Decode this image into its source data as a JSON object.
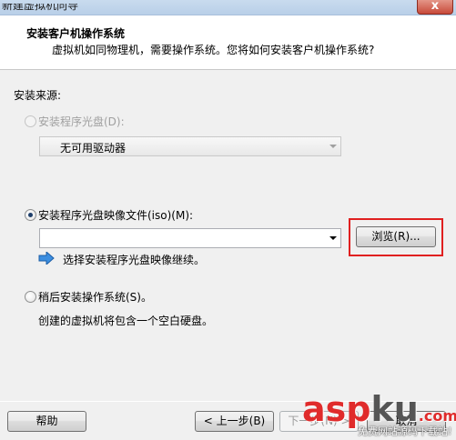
{
  "window": {
    "title": "新建虚拟机向导",
    "close_glyph": "x"
  },
  "header": {
    "title": "安装客户机操作系统",
    "subtitle": "虚拟机如同物理机，需要操作系统。您将如何安装客户机操作系统?"
  },
  "install_source": {
    "label": "安装来源:",
    "disc_option": {
      "label": "安装程序光盘(D):",
      "selected": false,
      "enabled": false
    },
    "disc_combo": {
      "value": "无可用驱动器",
      "enabled": false
    },
    "iso_option": {
      "label": "安装程序光盘映像文件(iso)(M):",
      "selected": true,
      "enabled": true
    },
    "iso_path": {
      "value": ""
    },
    "browse_button": "浏览(R)...",
    "hint": "选择安装程序光盘映像继续。",
    "hint_icon": "blue-right-arrow-icon",
    "later_option": {
      "label": "稍后安装操作系统(S)。",
      "selected": false,
      "enabled": true
    },
    "later_desc": "创建的虚拟机将包含一个空白硬盘。"
  },
  "footer": {
    "help_button": "帮助",
    "back_button": "< 上一步(B)",
    "next_button": "下一步(N) >",
    "cancel_button": "取消"
  },
  "watermark": {
    "logo_a": "asp",
    "logo_b": "ku",
    "logo_c": ".com",
    "sub": "免费网站源码下载站!"
  },
  "colors": {
    "highlight": "#e02020",
    "accent": "#1f6fb5"
  }
}
